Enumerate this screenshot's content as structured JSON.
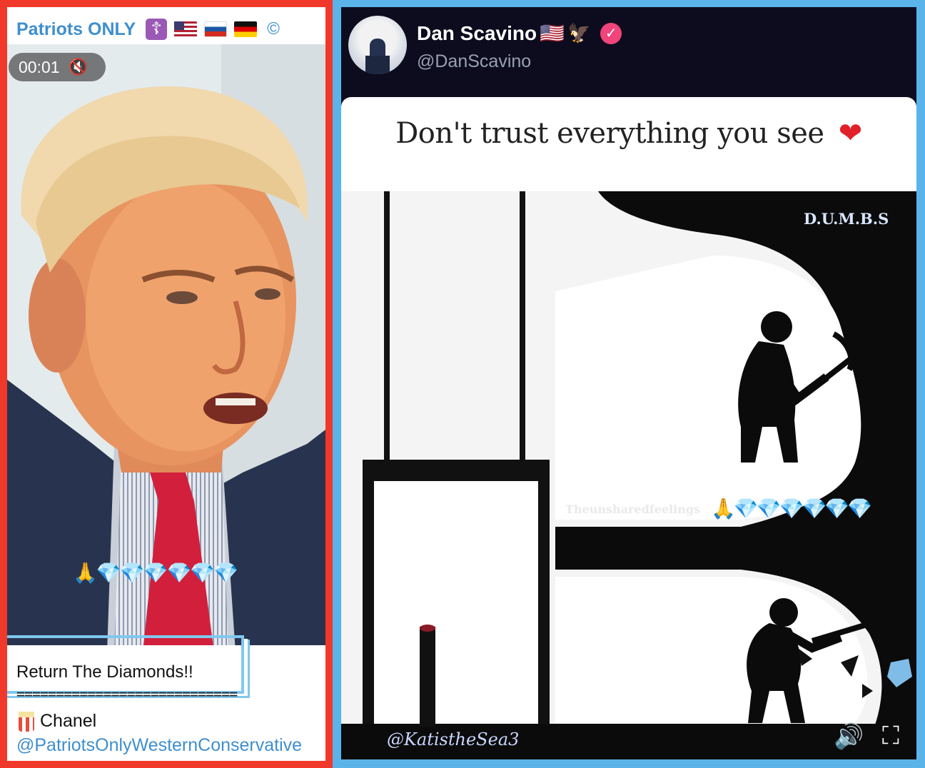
{
  "left": {
    "channel_name": "Patriots ONLY",
    "header_icons": [
      "orthodox-cross-badge",
      "us-flag",
      "russia-flag",
      "germany-flag"
    ],
    "copyright_symbol": "©",
    "video": {
      "timer": "00:01",
      "mute_symbol": "🔇",
      "emoji_row": "🙏💎💎💎💎💎💎"
    },
    "caption": {
      "title": "Return The Diamonds!!",
      "divider": "============================",
      "chanel_label": "Chanel",
      "handle": "@PatriotsOnlyWesternConservative"
    }
  },
  "right": {
    "tweet": {
      "name": "Dan Scavino",
      "name_flag": "🇺🇸",
      "eagle": "🦅",
      "verified": "✓",
      "handle": "@DanScavino"
    },
    "meme": {
      "title": "Don't trust everything you see",
      "heart": "❤",
      "dumbs_label": "D.U.M.B.S",
      "source_watermark": "Theunsharedfeelings",
      "emoji_row": "🙏💎💎💎💎💎💎",
      "user_watermark": "@KatistheSea3"
    },
    "controls": {
      "volume_symbol": "🔊",
      "fullscreen_symbol": "⛶"
    }
  },
  "colors": {
    "left_border": "#f0392b",
    "right_border": "#5ab4ea",
    "link_blue": "#3f8fcf",
    "verified_pink": "#f0447a",
    "header_dark": "#0c0c1e"
  }
}
